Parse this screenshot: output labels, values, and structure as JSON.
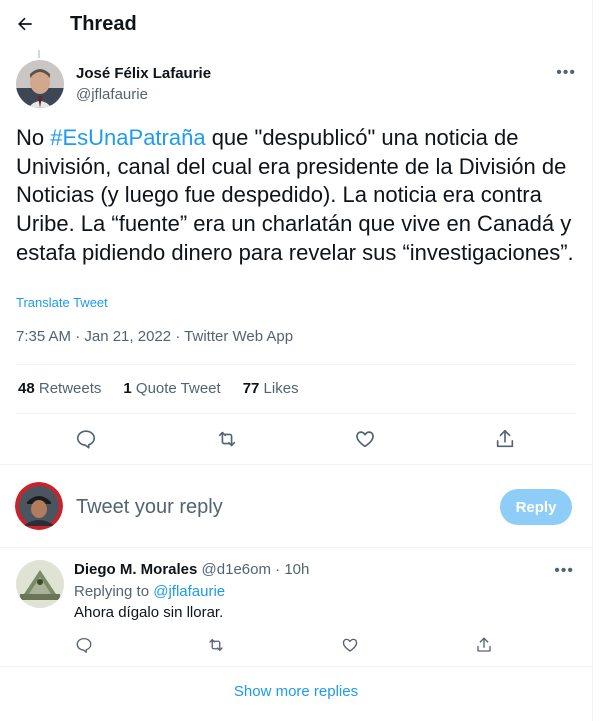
{
  "header": {
    "title": "Thread",
    "back_icon": "arrow-left-icon"
  },
  "tweet": {
    "author_name": "José Félix Lafaurie",
    "author_handle": "@jflafaurie",
    "text_parts": {
      "p1": "No ",
      "hashtag": "#EsUnaPatraña",
      "p2": " que \"despublicó\" una noticia de Univisión, canal del cual era presidente de la División de Noticias (y luego fue despedido). La noticia era contra Uribe. La “fuente” era un charlatán que vive en Canadá y estafa pidiendo dinero para revelar sus “investigaciones”."
    },
    "translate_label": "Translate Tweet",
    "meta": "7:35 AM · Jan 21, 2022 · Twitter Web App",
    "stats": {
      "retweets_count": "48",
      "retweets_label": "Retweets",
      "quotes_count": "1",
      "quotes_label": "Quote Tweet",
      "likes_count": "77",
      "likes_label": "Likes"
    }
  },
  "compose": {
    "placeholder": "Tweet your reply",
    "button_label": "Reply"
  },
  "reply": {
    "author_name": "Diego M. Morales",
    "author_handle": "@d1e6om",
    "separator": "·",
    "time": "10h",
    "replying_prefix": "Replying to ",
    "replying_handle": "@jflafaurie",
    "text": "Ahora dígalo sin llorar."
  },
  "show_more_label": "Show more replies",
  "colors": {
    "accent": "#1d9bf0",
    "reply_button_disabled": "#8ecdf8",
    "muted": "#536471",
    "text": "#0f1419"
  }
}
